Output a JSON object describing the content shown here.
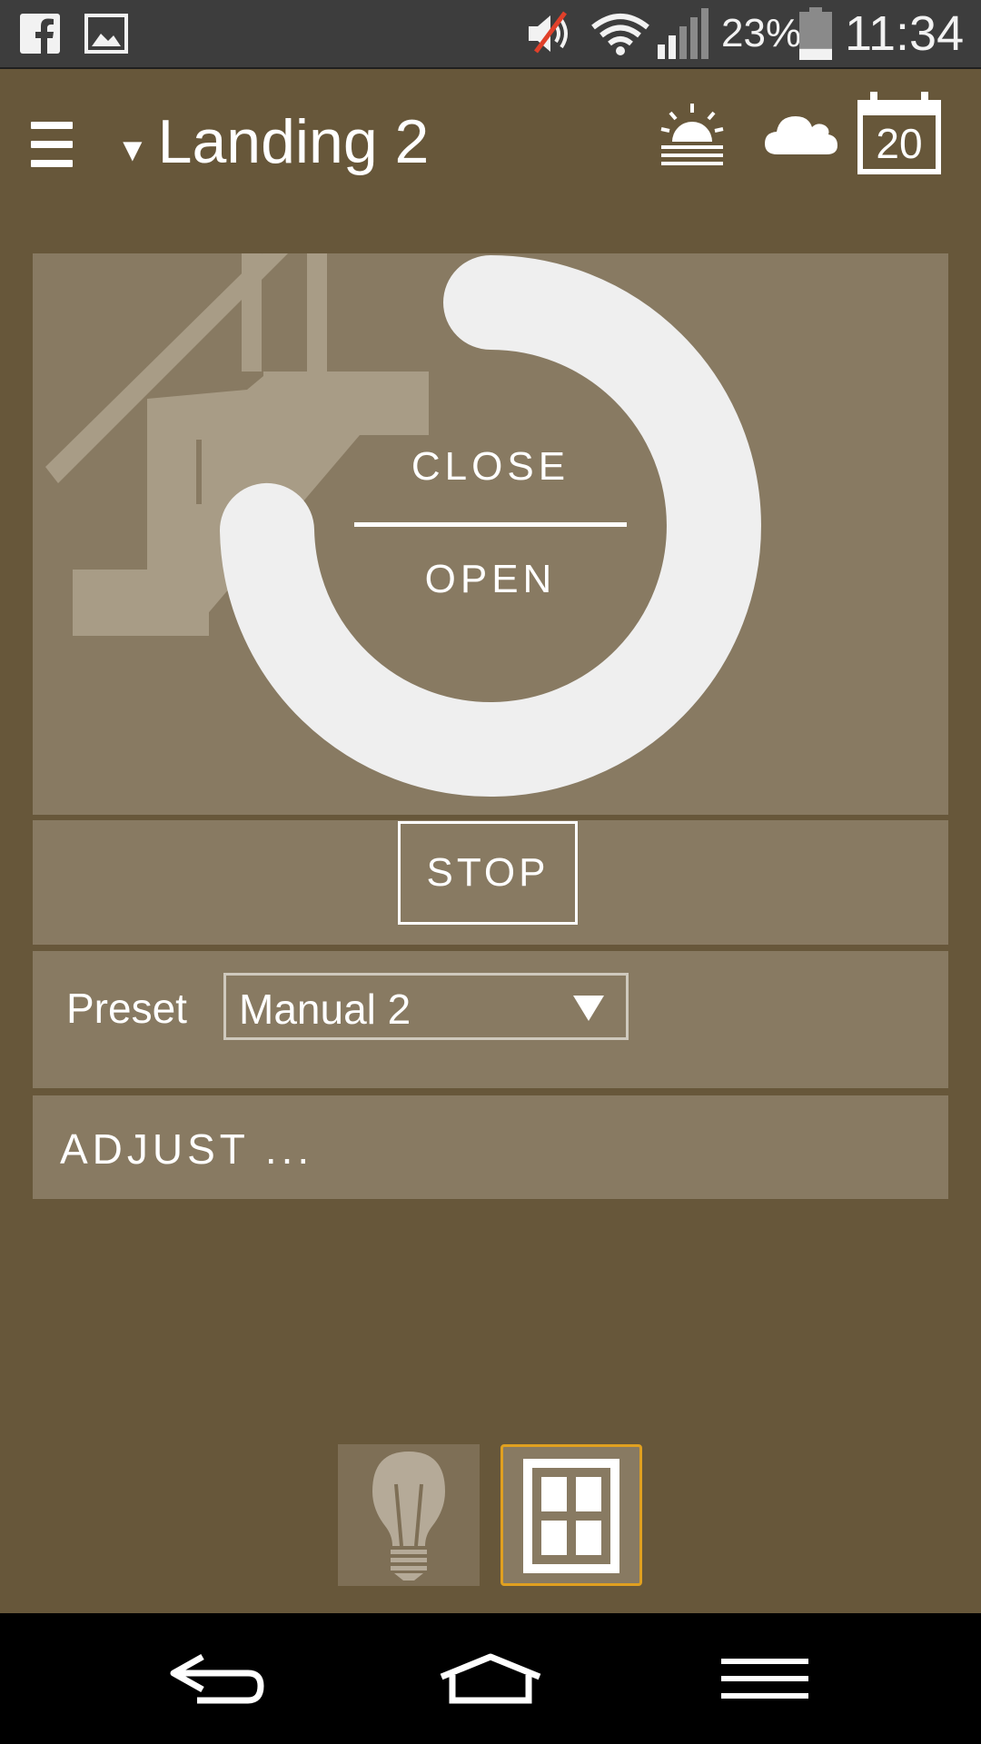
{
  "status_bar": {
    "notification_icons": [
      "facebook-icon",
      "image-icon"
    ],
    "system_icons": [
      "volume-muted-icon",
      "wifi-icon",
      "signal-icon",
      "battery-icon"
    ],
    "battery_percent": "23%",
    "battery_level": 0.23,
    "time": "11:34"
  },
  "app_bar": {
    "title": "Landing 2",
    "calendar_day": "20",
    "icons": [
      "menu-icon",
      "dropdown-caret-icon",
      "sunrise-icon",
      "cloud-icon",
      "calendar-icon"
    ]
  },
  "control": {
    "close_label": "CLOSE",
    "open_label": "OPEN",
    "background_icon": "staircase-icon"
  },
  "stop": {
    "label": "STOP"
  },
  "preset": {
    "label": "Preset",
    "selected": "Manual 2"
  },
  "adjust": {
    "label": "ADJUST ..."
  },
  "bottom_tabs": [
    {
      "icon": "lightbulb-icon",
      "active": false
    },
    {
      "icon": "window-icon",
      "active": true
    }
  ],
  "nav_bar": {
    "icons": [
      "back-icon",
      "home-icon",
      "recent-apps-icon"
    ]
  },
  "colors": {
    "background": "#67573a",
    "card": "#887a62",
    "accent": "#e0a020",
    "ring": "#efefef"
  }
}
